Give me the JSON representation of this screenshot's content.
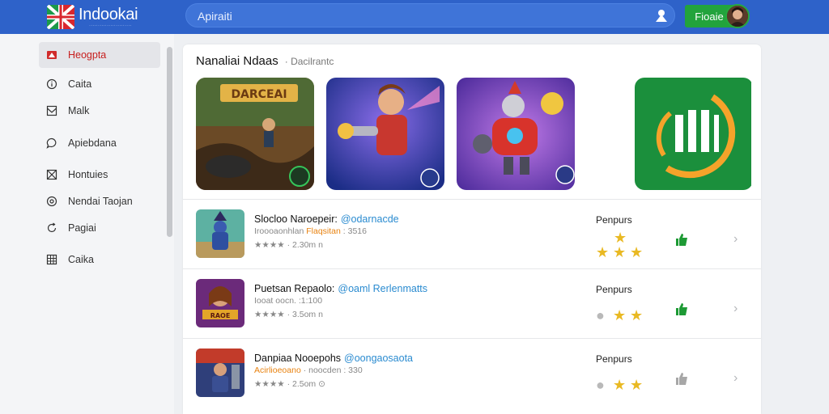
{
  "app": {
    "brand": "Indookai",
    "brand_sub": "························"
  },
  "search": {
    "placeholder": "Apiraiti"
  },
  "header": {
    "install_label": "Fioaie"
  },
  "sidebar": {
    "items": [
      {
        "label": "Heogpta",
        "icon": "flag-icon",
        "active": true
      },
      {
        "label": "Caita",
        "icon": "info-icon"
      },
      {
        "label": "Malk",
        "icon": "inbox-icon"
      },
      {
        "label": "Apiebdana",
        "icon": "chat-icon"
      },
      {
        "label": "Hontuies",
        "icon": "expand-icon"
      },
      {
        "label": "Nendai Taojan",
        "icon": "settings-icon"
      },
      {
        "label": "Pagiai",
        "icon": "refresh-icon"
      },
      {
        "label": "Caika",
        "icon": "grid-icon"
      }
    ]
  },
  "featured": {
    "title": "Nanaliai Ndaas",
    "subtitle": "· Dacilrantc",
    "tiles": [
      "adventure-game-tile",
      "hero-game-tile",
      "robot-game-tile",
      "green-logo-tile"
    ]
  },
  "list": [
    {
      "title": "Slocloo Naroepeir:",
      "handle": "@odarnacde",
      "meta_plain": "Iroooaonhlan",
      "meta_accent": "Flaqsitan",
      "meta_rest": ": 3516",
      "stats": "★★★★ · 2.30m n",
      "category": "Penpurs",
      "rating": [
        1,
        1,
        1
      ],
      "thumb_color": "#1e9a35"
    },
    {
      "title": "Puetsan Repaolo:",
      "handle": "@oaml Rerlenmatts",
      "meta_plain": "Iooat oocn. :1:100",
      "meta_accent": "",
      "meta_rest": "",
      "stats": "★★★★ · 3.5om n",
      "category": "Penpurs",
      "rating": [
        0,
        1,
        1
      ],
      "thumb_color": "#1e9a35"
    },
    {
      "title": "Danpiaa Nooepohs",
      "handle": "@oongaosaota",
      "meta_plain": "",
      "meta_accent": "Acirlioeoano",
      "meta_rest": "· noocden : 330",
      "stats": "★★★★ · 2.5om ⊙",
      "category": "Penpurs",
      "rating": [
        0,
        1,
        1
      ],
      "thumb_color": "#a7a7a7"
    }
  ]
}
